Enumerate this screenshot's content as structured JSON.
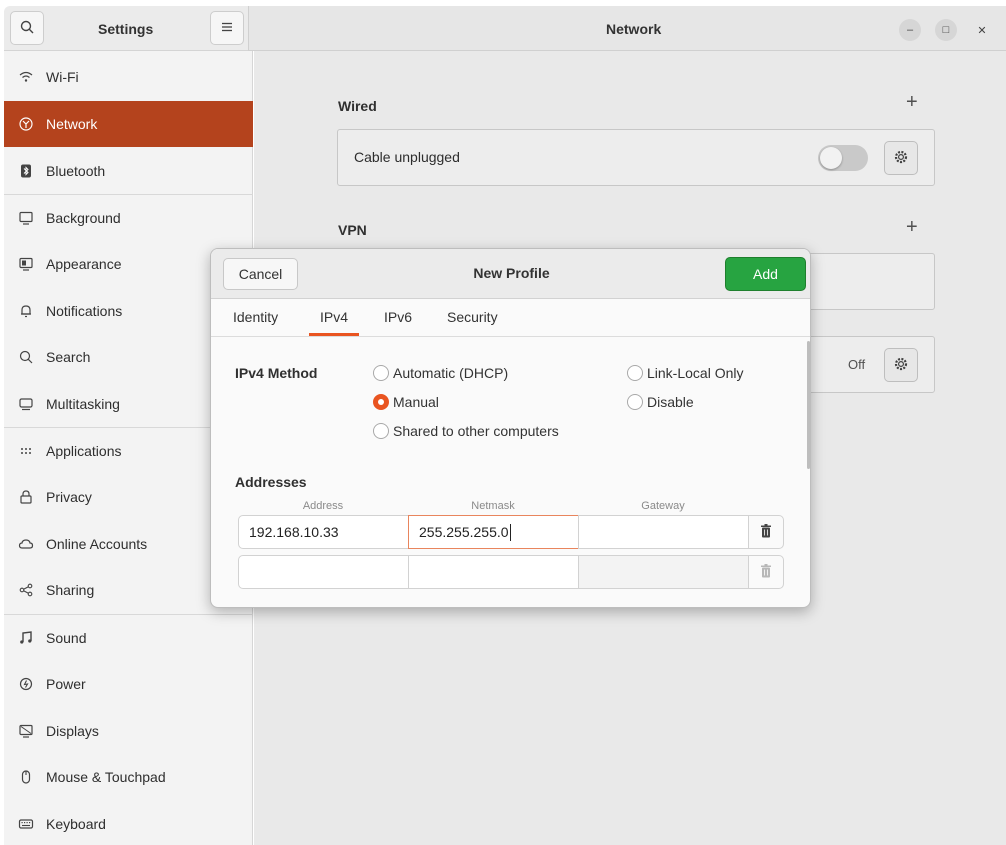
{
  "header": {
    "settings_title": "Settings",
    "page_title": "Network"
  },
  "sidebar": {
    "items": [
      {
        "label": "Wi-Fi",
        "icon": "wifi-icon"
      },
      {
        "label": "Network",
        "icon": "network-icon",
        "active": true
      },
      {
        "label": "Bluetooth",
        "icon": "bluetooth-icon"
      },
      {
        "label": "Background",
        "icon": "background-icon"
      },
      {
        "label": "Appearance",
        "icon": "appearance-icon"
      },
      {
        "label": "Notifications",
        "icon": "bell-icon"
      },
      {
        "label": "Search",
        "icon": "search-icon"
      },
      {
        "label": "Multitasking",
        "icon": "multitasking-icon"
      },
      {
        "label": "Applications",
        "icon": "apps-grid-icon"
      },
      {
        "label": "Privacy",
        "icon": "lock-icon"
      },
      {
        "label": "Online Accounts",
        "icon": "cloud-icon"
      },
      {
        "label": "Sharing",
        "icon": "share-icon"
      },
      {
        "label": "Sound",
        "icon": "music-note-icon"
      },
      {
        "label": "Power",
        "icon": "power-icon"
      },
      {
        "label": "Displays",
        "icon": "display-icon"
      },
      {
        "label": "Mouse & Touchpad",
        "icon": "mouse-icon"
      },
      {
        "label": "Keyboard",
        "icon": "keyboard-icon"
      }
    ]
  },
  "main": {
    "wired_title": "Wired",
    "wired_status": "Cable unplugged",
    "vpn_title": "VPN",
    "proxy_state": "Off"
  },
  "dialog": {
    "title": "New Profile",
    "cancel_label": "Cancel",
    "add_label": "Add",
    "tabs": [
      "Identity",
      "IPv4",
      "IPv6",
      "Security"
    ],
    "active_tab": "IPv4",
    "method_label": "IPv4 Method",
    "methods": {
      "automatic": "Automatic (DHCP)",
      "link_local": "Link-Local Only",
      "manual": "Manual",
      "disable": "Disable",
      "shared": "Shared to other computers"
    },
    "selected_method": "Manual",
    "addresses_label": "Addresses",
    "columns": {
      "address": "Address",
      "netmask": "Netmask",
      "gateway": "Gateway"
    },
    "rows": [
      {
        "address": "192.168.10.33",
        "netmask": "255.255.255.0",
        "gateway": ""
      },
      {
        "address": "",
        "netmask": "",
        "gateway": ""
      }
    ]
  },
  "colors": {
    "accent": "#e95420",
    "sidebar_active": "#b4431d",
    "add_button": "#27a441"
  }
}
